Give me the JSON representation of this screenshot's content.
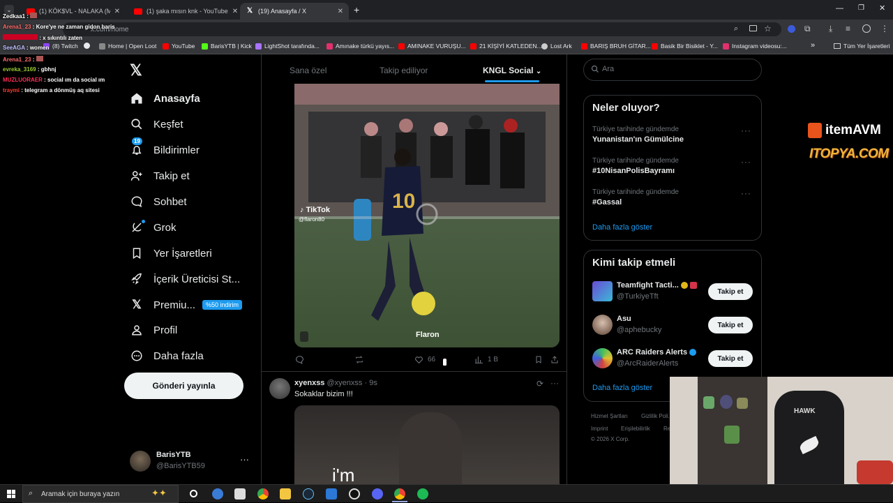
{
  "browser": {
    "tabs": [
      {
        "title": "(1) KÖK$VL - NALAKA (Music V",
        "type": "youtube"
      },
      {
        "title": "(1) şaka mısın knk - YouTube",
        "type": "youtube"
      },
      {
        "title": "(19) Anasayfa / X",
        "type": "x",
        "active": true
      }
    ],
    "new_tab": "+",
    "url": "x.com/home",
    "bookmarks": [
      {
        "label": "(8) Twitch",
        "color": "#9146ff"
      },
      {
        "label": "",
        "color": "#4285f4"
      },
      {
        "label": "Home | Open Loot",
        "color": "#888888"
      },
      {
        "label": "YouTube",
        "color": "#ff0000"
      },
      {
        "label": "BarisYTB | Kick",
        "color": "#53fc18"
      },
      {
        "label": "LightShot tarafında...",
        "color": "#a974ff"
      },
      {
        "label": "Amınake türkü yayıs...",
        "color": "#e1306c"
      },
      {
        "label": "AMINAKE VURUŞU...",
        "color": "#ff0000"
      },
      {
        "label": "21 KİŞİYİ KATLEDEN...",
        "color": "#ff0000"
      },
      {
        "label": "Lost Ark",
        "color": "#cccccc"
      },
      {
        "label": "BARIŞ BRUH GİTAR...",
        "color": "#ff0000"
      },
      {
        "label": "Basik Bir Bisiklet - Y...",
        "color": "#ff0000"
      },
      {
        "label": "Instagram videosu:...",
        "color": "#e1306c"
      }
    ],
    "bookmarks_more": "»",
    "all_bookmarks": "Tüm Yer İşaretleri"
  },
  "stream_chat": [
    {
      "user": "Zedkaa1",
      "user_color": "#ffffff",
      "msg": ""
    },
    {
      "user": "Arena1_23",
      "user_color": "#ff6b6b",
      "msg": "Kore'ye ne zaman gidon baris"
    },
    {
      "user": "",
      "user_color": "#ff4500",
      "msg": "x sıkıntılı zaten"
    },
    {
      "user": "SeeAGA",
      "user_color": "#c0c0ff",
      "msg": "women"
    },
    {
      "user": "Arena1_23",
      "user_color": "#ff6b6b",
      "msg": ""
    },
    {
      "user": "evreka_3169",
      "user_color": "#9acd32",
      "msg": "gbhnj"
    },
    {
      "user": "MUZLUORAER",
      "user_color": "#ff2d55",
      "msg": "social ım da social ım"
    },
    {
      "user": "traymi",
      "user_color": "#ff3b30",
      "msg": "telegram a dönmüş aq sitesi"
    }
  ],
  "nav": {
    "items": [
      {
        "label": "Anasayfa",
        "icon": "home-icon"
      },
      {
        "label": "Keşfet",
        "icon": "search-icon"
      },
      {
        "label": "Bildirimler",
        "icon": "bell-icon",
        "badge": "19"
      },
      {
        "label": "Takip et",
        "icon": "follow-icon"
      },
      {
        "label": "Sohbet",
        "icon": "chat-icon"
      },
      {
        "label": "Grok",
        "icon": "grok-icon"
      },
      {
        "label": "Yer İşaretleri",
        "icon": "bookmark-icon"
      },
      {
        "label": "İçerik Üreticisi St...",
        "icon": "rocket-icon"
      },
      {
        "label": "Premiu...",
        "icon": "x-icon",
        "badge": "%50 indirim"
      },
      {
        "label": "Profil",
        "icon": "user-icon"
      },
      {
        "label": "Daha fazla",
        "icon": "more-icon"
      }
    ],
    "post_button": "Gönderi yayınla",
    "account": {
      "name": "BarisYTB",
      "handle": "@BarisYTB59"
    }
  },
  "feed": {
    "tabs": [
      "Sana özel",
      "Takip ediliyor",
      "KNGL Social"
    ],
    "active_tab": "KNGL Social",
    "video1": {
      "tiktok_label": "TikTok",
      "tiktok_user": "@flaron80",
      "jersey_number": "10",
      "caption": "Flaron",
      "likes": "66",
      "views": "1 B"
    },
    "post2": {
      "name": "xyenxss",
      "handle": "@xyenxss",
      "time": "9s",
      "text": "Sokaklar bizim !!!",
      "video_text": "i'm"
    }
  },
  "right": {
    "search_placeholder": "Ara",
    "trends_title": "Neler oluyor?",
    "trends": [
      {
        "meta": "Türkiye tarihinde gündemde",
        "name": "Yunanistan'ın Gümülcine"
      },
      {
        "meta": "Türkiye tarihinde gündemde",
        "name": "#10NisanPolisBayramı"
      },
      {
        "meta": "Türkiye tarihinde gündemde",
        "name": "#Gassal"
      }
    ],
    "trends_more": "Daha fazla göster",
    "who_title": "Kimi takip etmeli",
    "who": [
      {
        "name": "Teamfight Tacti...",
        "handle": "@TurkiyeTft",
        "button": "Takip et",
        "verified": "gold"
      },
      {
        "name": "Asu",
        "handle": "@aphebucky",
        "button": "Takip et",
        "verified": ""
      },
      {
        "name": "ARC Raiders Alerts",
        "handle": "@ArcRaiderAlerts",
        "button": "Takip et",
        "verified": "blue"
      }
    ],
    "who_more": "Daha fazla göster",
    "footer": [
      "Hizmet Şartları",
      "Gizlilik Poli...",
      "Imprint",
      "Erişilebilirlik",
      "Re...",
      "© 2026 X Corp."
    ]
  },
  "overlay": {
    "sponsor1": "itemAVM",
    "sponsor2": "ITOPYA.COM",
    "chair_brand": "HAWK"
  },
  "taskbar": {
    "search_placeholder": "Aramak için buraya yazın"
  }
}
